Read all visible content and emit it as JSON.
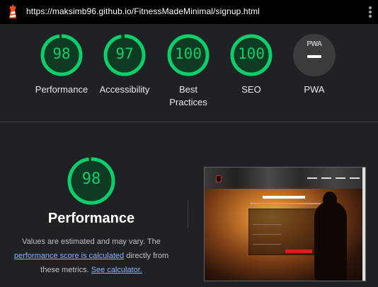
{
  "browser": {
    "url": "https://maksimb96.github.io/FitnessMadeMinimal/signup.html",
    "logo_icon": "lighthouse-icon",
    "menu_icon": "kebab-menu-icon"
  },
  "colors": {
    "pass": "#0cce6b",
    "pass_bg": "#0f3b22",
    "background": "#202124",
    "link": "#8ab4f8"
  },
  "scores": [
    {
      "label": "Performance",
      "value": "98",
      "fraction": 0.98
    },
    {
      "label": "Accessibility",
      "value": "97",
      "fraction": 0.97
    },
    {
      "label": "Best Practices",
      "value": "100",
      "fraction": 1.0
    },
    {
      "label": "SEO",
      "value": "100",
      "fraction": 1.0
    }
  ],
  "pwa": {
    "label": "PWA",
    "badge_text": "PWA"
  },
  "detail": {
    "score": "98",
    "fraction": 0.98,
    "title": "Performance",
    "desc_1": "Values are estimated and may vary. The",
    "link_1": "performance score is calculated",
    "desc_2": "directly from these metrics.",
    "link_2": "See calculator."
  }
}
